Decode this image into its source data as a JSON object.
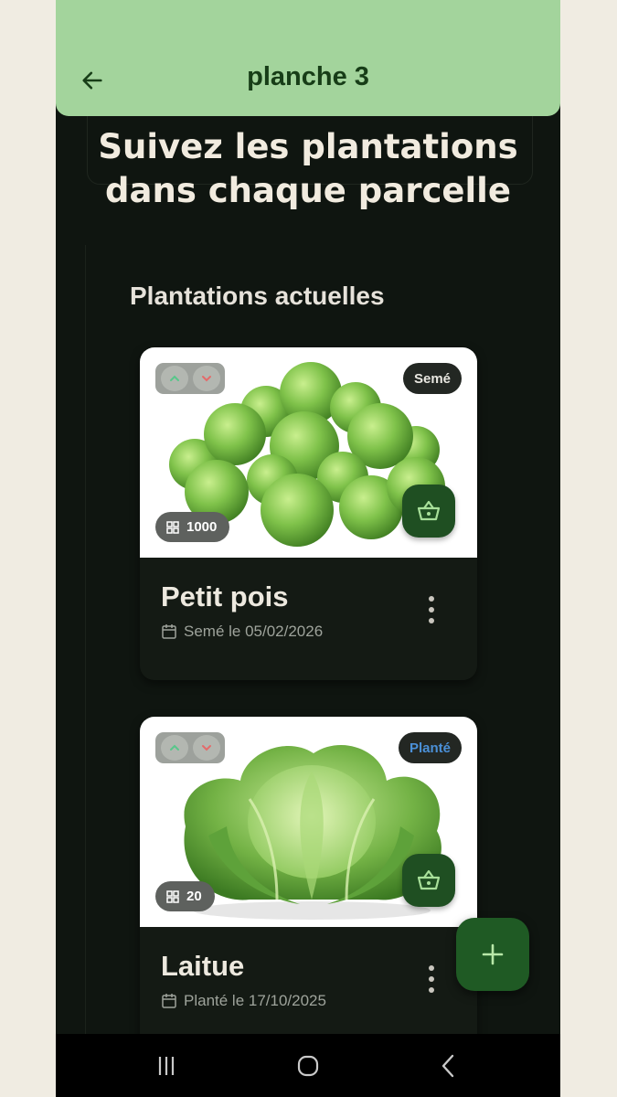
{
  "appbar": {
    "title": "planche 3",
    "back_icon": "arrow-left-icon",
    "background": "#a3d49c"
  },
  "hero": {
    "line1": "Suivez les plantations",
    "line2": "dans chaque parcelle"
  },
  "section": {
    "title": "Plantations actuelles"
  },
  "plantings": [
    {
      "name": "Petit pois",
      "status": "Semé",
      "quantity": "1000",
      "date_text": "Semé le 05/02/2026",
      "image": "green-peas"
    },
    {
      "name": "Laitue",
      "status": "Planté",
      "quantity": "20",
      "date_text": "Planté le 17/10/2025",
      "image": "lettuce-head"
    }
  ],
  "fab": {
    "icon": "plus-icon"
  },
  "navbar": {
    "icons": [
      "recent-apps-icon",
      "home-icon",
      "back-nav-icon"
    ]
  },
  "colors": {
    "background": "#0f1510",
    "accent_dark": "#1f5a24",
    "status_planted": "#4b90d8"
  }
}
